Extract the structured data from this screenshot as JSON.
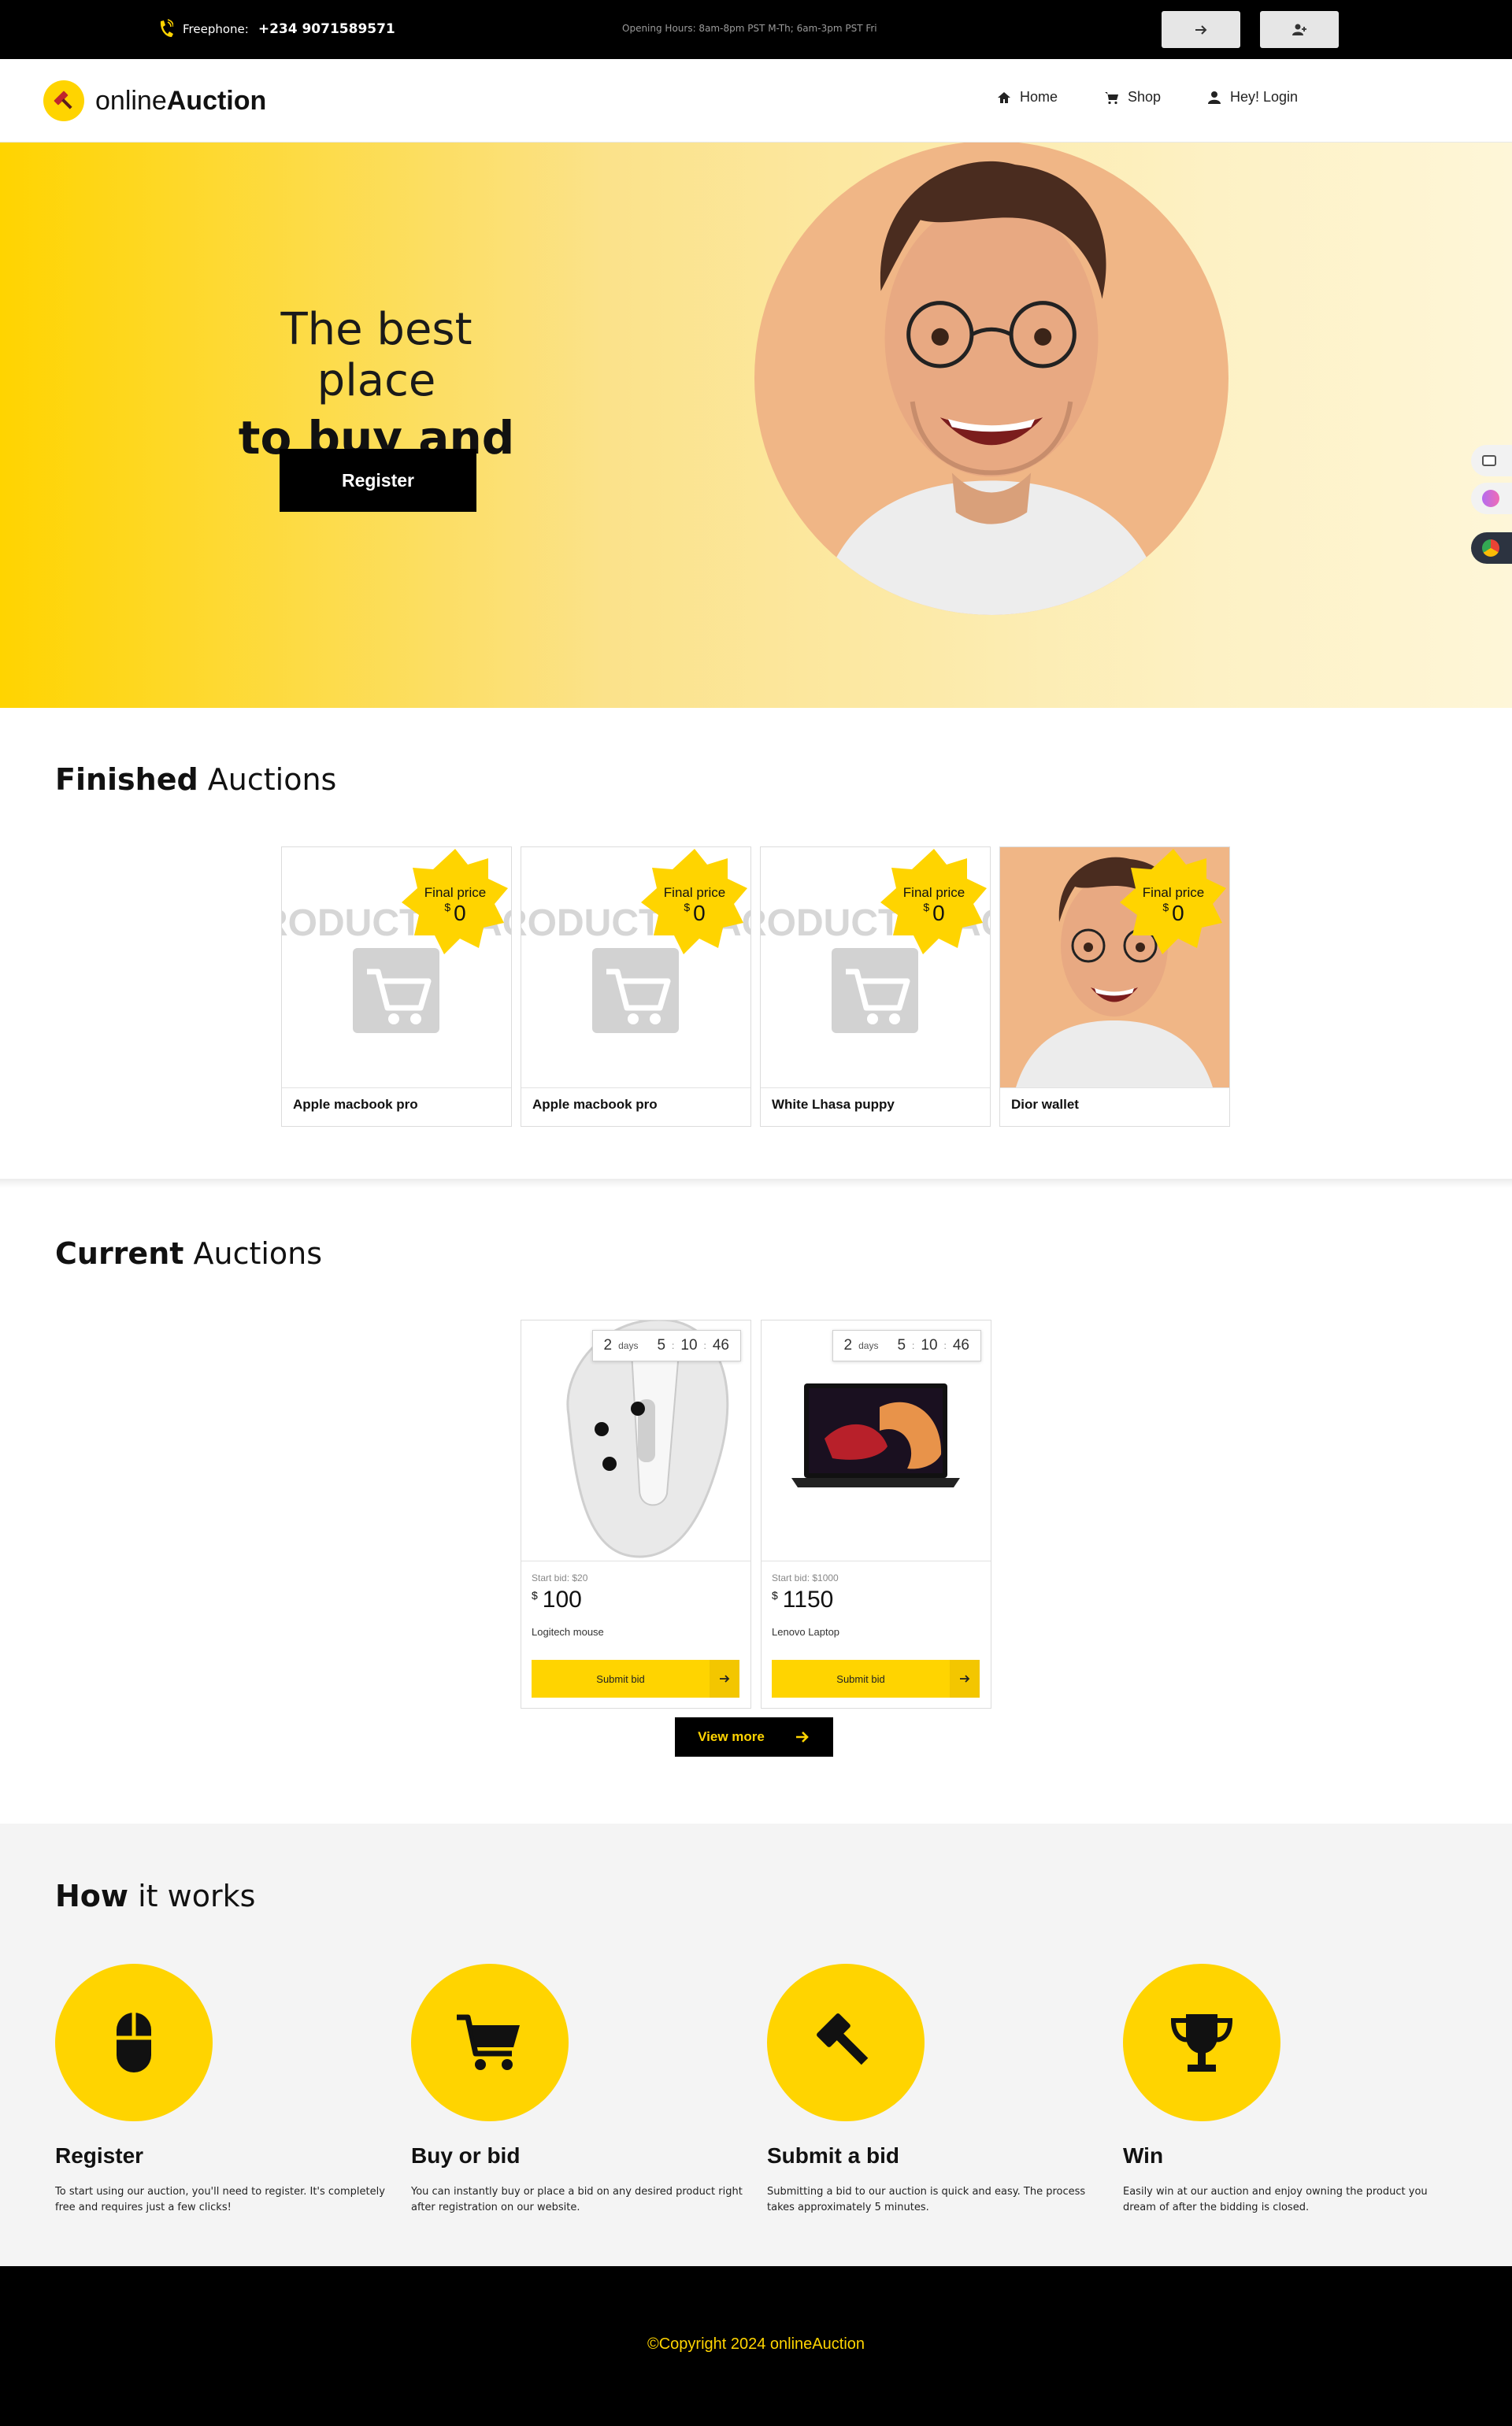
{
  "topbar": {
    "phone_label": "Freephone:",
    "phone_number": "+234 9071589571",
    "hours": "Opening Hours: 8am-8pm PST M-Th; 6am-3pm PST Fri"
  },
  "brand": {
    "name_light": "online",
    "name_bold": "Auction"
  },
  "nav": {
    "home": "Home",
    "shop": "Shop",
    "login": "Hey! Login"
  },
  "hero": {
    "line1": "The best place",
    "line2": "to buy and sell!",
    "register": "Register"
  },
  "finished": {
    "title_bold": "Finished",
    "title_rest": " Auctions",
    "final_label": "Final price",
    "currency": "$",
    "items": [
      {
        "name": "Apple macbook pro",
        "price": "0"
      },
      {
        "name": "Apple macbook pro",
        "price": "0"
      },
      {
        "name": "White Lhasa puppy",
        "price": "0"
      },
      {
        "name": "Dior wallet",
        "price": "0"
      }
    ]
  },
  "placeholder_text": "PRODUCT IMAGE",
  "current": {
    "title_bold": "Current",
    "title_rest": " Auctions",
    "days_unit": "days",
    "submit_label": "Submit bid",
    "view_more": "View more",
    "currency": "$",
    "items": [
      {
        "name": "Logitech mouse",
        "start": "Start bid: $20",
        "price": "100",
        "days": "2",
        "h": "5",
        "m": "10",
        "s": "46"
      },
      {
        "name": "Lenovo Laptop",
        "start": "Start bid: $1000",
        "price": "1150",
        "days": "2",
        "h": "5",
        "m": "10",
        "s": "46"
      }
    ]
  },
  "how": {
    "title_bold": "How",
    "title_rest": " it works",
    "steps": [
      {
        "title": "Register",
        "text": "To start using our auction, you'll need to register. It's completely free and requires just a few clicks!",
        "icon": "mouse-icon"
      },
      {
        "title": "Buy or bid",
        "text": "You can instantly buy or place a bid on any desired product right after registration on our website.",
        "icon": "cart-icon"
      },
      {
        "title": "Submit a bid",
        "text": "Submitting a bid to our auction is quick and easy. The process takes approximately 5 minutes.",
        "icon": "gavel-icon"
      },
      {
        "title": "Win",
        "text": "Easily win at our auction and enjoy owning the product you dream of after the bidding is closed.",
        "icon": "trophy-icon"
      }
    ]
  },
  "footer": {
    "copyright": "©Copyright 2024 onlineAuction"
  },
  "colors": {
    "accent": "#ffd400",
    "dark": "#000000"
  }
}
